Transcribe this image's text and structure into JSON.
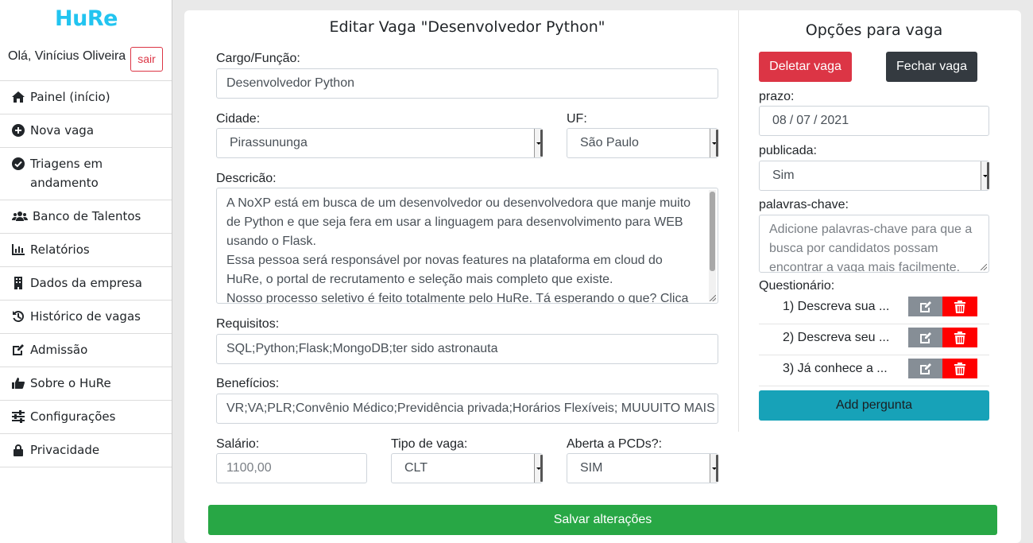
{
  "brand": {
    "logo": "HuRe"
  },
  "user": {
    "greeting": "Olá, Vinícius Oliveira",
    "logout_label": "sair"
  },
  "nav": [
    {
      "icon": "home-icon",
      "label": "Painel (início)"
    },
    {
      "icon": "plus-circle-icon",
      "label": "Nova vaga"
    },
    {
      "icon": "check-circle-icon",
      "label": "Triagens em andamento"
    },
    {
      "icon": "users-icon",
      "label": "Banco de Talentos"
    },
    {
      "icon": "chart-bar-icon",
      "label": "Relatórios"
    },
    {
      "icon": "building-icon",
      "label": "Dados da empresa"
    },
    {
      "icon": "history-icon",
      "label": "Histórico de vagas"
    },
    {
      "icon": "edit-doc-icon",
      "label": "Admissão"
    },
    {
      "icon": "thumbs-up-icon",
      "label": "Sobre o HuRe"
    },
    {
      "icon": "sliders-icon",
      "label": "Configurações"
    },
    {
      "icon": "lock-icon",
      "label": "Privacidade"
    }
  ],
  "form": {
    "title": "Editar Vaga \"Desenvolvedor Python\"",
    "cargo_label": "Cargo/Função:",
    "cargo_value": "Desenvolvedor Python",
    "cidade_label": "Cidade:",
    "cidade_value": "Pirassununga",
    "uf_label": "UF:",
    "uf_value": "São Paulo",
    "descricao_label": "Descricão:",
    "descricao_lines": [
      "A NoXP está em busca de um desenvolvedor ou desenvolvedora que manje muito",
      "de Python e que seja fera em usar a linguagem para desenvolvimento para WEB",
      "usando o Flask.",
      "Essa pessoa será responsável por novas features na plataforma em cloud do",
      "HuRe, o portal de recrutamento e seleção mais completo que existe.",
      "Nosso processo seletivo é feito totalmente pelo HuRe. Tá esperando o que? Clica"
    ],
    "requisitos_label": "Requisitos:",
    "requisitos_value": "SQL;Python;Flask;MongoDB;ter sido astronauta",
    "beneficios_label": "Benefícios:",
    "beneficios_value": "VR;VA;PLR;Convênio Médico;Previdência privada;Horários Flexíveis; MUUUITO MAIS",
    "salario_label": "Salário:",
    "salario_placeholder": "1100,00",
    "tipo_label": "Tipo de vaga:",
    "tipo_value": "CLT",
    "pcd_label": "Aberta a PCDs?:",
    "pcd_value": "SIM",
    "save_label": "Salvar alterações"
  },
  "options": {
    "title": "Opções para vaga",
    "delete_label": "Deletar vaga",
    "close_label": "Fechar vaga",
    "prazo_label": "prazo:",
    "prazo_day": "08",
    "prazo_month": "07",
    "prazo_year": "2021",
    "publicada_label": "publicada:",
    "publicada_value": "Sim",
    "keywords_label": "palavras-chave:",
    "keywords_placeholder": "Adicione palavras-chave para que a busca por candidatos possam encontrar a vaga mais facilmente.",
    "questionario_label": "Questionário:",
    "questions": [
      "1) Descreva sua ...",
      "2) Descreva seu ...",
      "3) Já conhece a ..."
    ],
    "add_question_label": "Add pergunta"
  },
  "colors": {
    "brand": "#22c4f0",
    "danger": "#dc3545",
    "success": "#28a745",
    "info": "#17a2b8",
    "dark": "#343a40"
  }
}
